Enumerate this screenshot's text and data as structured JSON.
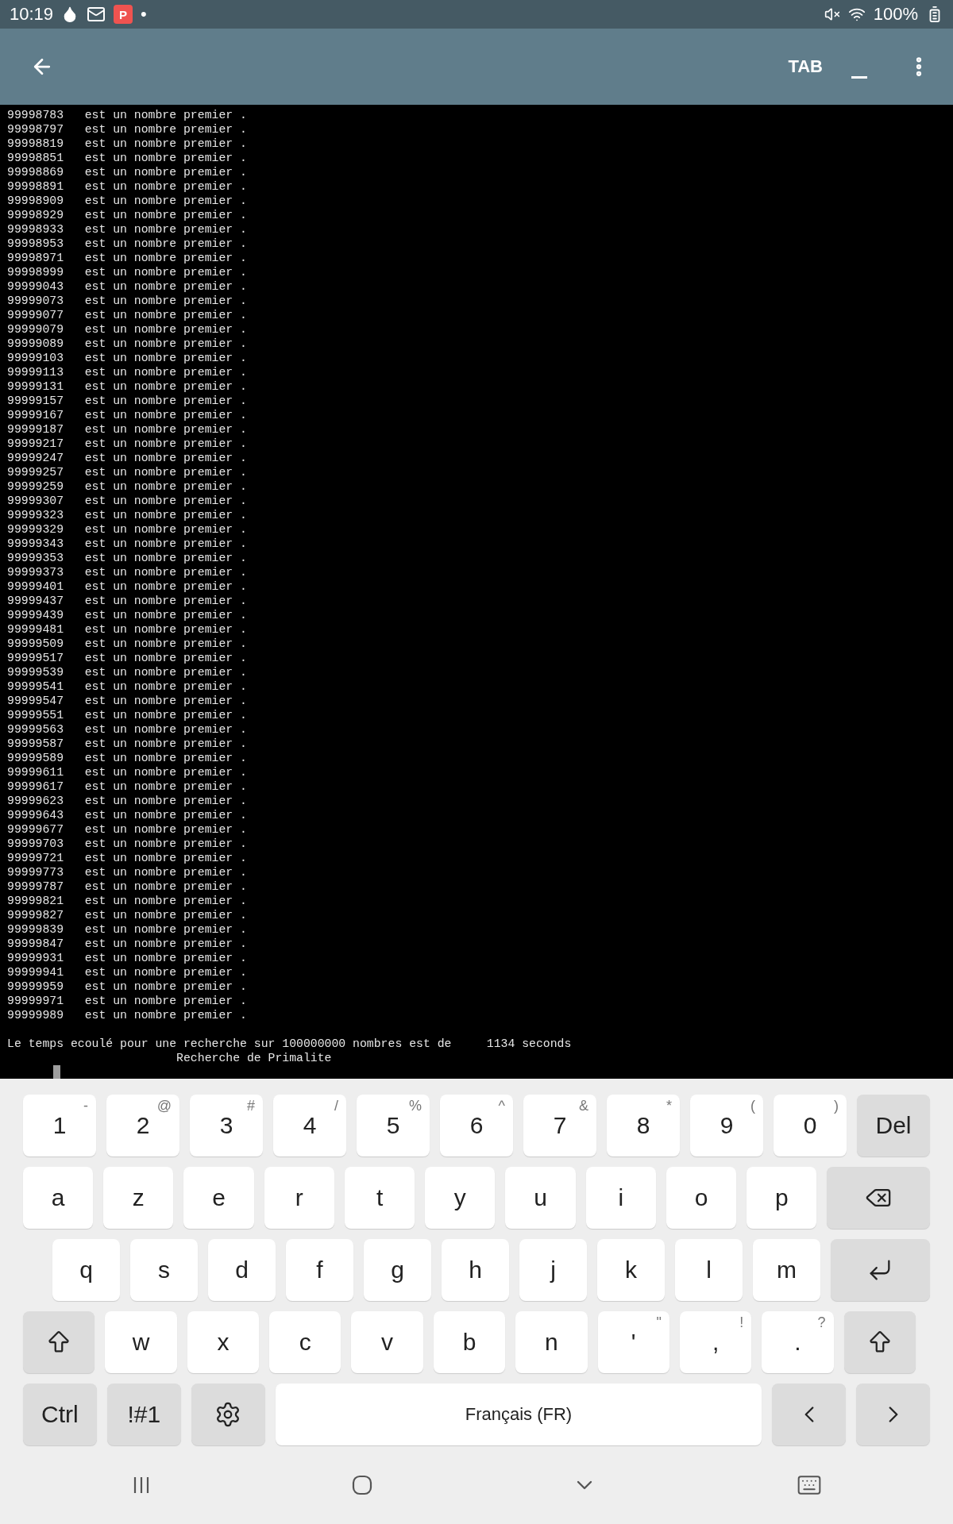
{
  "status_bar": {
    "time": "10:19",
    "app_badge": "P",
    "dot": "•",
    "battery": "100%"
  },
  "app_bar": {
    "tab_button": "TAB"
  },
  "terminal": {
    "lines": [
      "99998783   est un nombre premier .",
      "99998797   est un nombre premier .",
      "99998819   est un nombre premier .",
      "99998851   est un nombre premier .",
      "99998869   est un nombre premier .",
      "99998891   est un nombre premier .",
      "99998909   est un nombre premier .",
      "99998929   est un nombre premier .",
      "99998933   est un nombre premier .",
      "99998953   est un nombre premier .",
      "99998971   est un nombre premier .",
      "99998999   est un nombre premier .",
      "99999043   est un nombre premier .",
      "99999073   est un nombre premier .",
      "99999077   est un nombre premier .",
      "99999079   est un nombre premier .",
      "99999089   est un nombre premier .",
      "99999103   est un nombre premier .",
      "99999113   est un nombre premier .",
      "99999131   est un nombre premier .",
      "99999157   est un nombre premier .",
      "99999167   est un nombre premier .",
      "99999187   est un nombre premier .",
      "99999217   est un nombre premier .",
      "99999247   est un nombre premier .",
      "99999257   est un nombre premier .",
      "99999259   est un nombre premier .",
      "99999307   est un nombre premier .",
      "99999323   est un nombre premier .",
      "99999329   est un nombre premier .",
      "99999343   est un nombre premier .",
      "99999353   est un nombre premier .",
      "99999373   est un nombre premier .",
      "99999401   est un nombre premier .",
      "99999437   est un nombre premier .",
      "99999439   est un nombre premier .",
      "99999481   est un nombre premier .",
      "99999509   est un nombre premier .",
      "99999517   est un nombre premier .",
      "99999539   est un nombre premier .",
      "99999541   est un nombre premier .",
      "99999547   est un nombre premier .",
      "99999551   est un nombre premier .",
      "99999563   est un nombre premier .",
      "99999587   est un nombre premier .",
      "99999589   est un nombre premier .",
      "99999611   est un nombre premier .",
      "99999617   est un nombre premier .",
      "99999623   est un nombre premier .",
      "99999643   est un nombre premier .",
      "99999677   est un nombre premier .",
      "99999703   est un nombre premier .",
      "99999721   est un nombre premier .",
      "99999773   est un nombre premier .",
      "99999787   est un nombre premier .",
      "99999821   est un nombre premier .",
      "99999827   est un nombre premier .",
      "99999839   est un nombre premier .",
      "99999847   est un nombre premier .",
      "99999931   est un nombre premier .",
      "99999941   est un nombre premier .",
      "99999959   est un nombre premier .",
      "99999971   est un nombre premier .",
      "99999989   est un nombre premier ."
    ],
    "summary": [
      "Le temps ecoulé pour une recherche sur 100000000 nombres est de     1134 seconds",
      "                        Recherche de Primalite"
    ]
  },
  "keyboard": {
    "rows": [
      {
        "keys": [
          {
            "kind": "char",
            "label": "1",
            "sup": "-"
          },
          {
            "kind": "char",
            "label": "2",
            "sup": "@"
          },
          {
            "kind": "char",
            "label": "3",
            "sup": "#"
          },
          {
            "kind": "char",
            "label": "4",
            "sup": "/"
          },
          {
            "kind": "char",
            "label": "5",
            "sup": "%"
          },
          {
            "kind": "char",
            "label": "6",
            "sup": "^"
          },
          {
            "kind": "char",
            "label": "7",
            "sup": "&"
          },
          {
            "kind": "char",
            "label": "8",
            "sup": "*"
          },
          {
            "kind": "char",
            "label": "9",
            "sup": "("
          },
          {
            "kind": "char",
            "label": "0",
            "sup": ")"
          },
          {
            "kind": "function",
            "label": "Del"
          }
        ]
      },
      {
        "keys": [
          {
            "kind": "char",
            "label": "a"
          },
          {
            "kind": "char",
            "label": "z"
          },
          {
            "kind": "char",
            "label": "e"
          },
          {
            "kind": "char",
            "label": "r"
          },
          {
            "kind": "char",
            "label": "t"
          },
          {
            "kind": "char",
            "label": "y"
          },
          {
            "kind": "char",
            "label": "u"
          },
          {
            "kind": "char",
            "label": "i"
          },
          {
            "kind": "char",
            "label": "o"
          },
          {
            "kind": "char",
            "label": "p"
          },
          {
            "kind": "backspace"
          }
        ]
      },
      {
        "keys": [
          {
            "kind": "char",
            "label": "q"
          },
          {
            "kind": "char",
            "label": "s"
          },
          {
            "kind": "char",
            "label": "d"
          },
          {
            "kind": "char",
            "label": "f"
          },
          {
            "kind": "char",
            "label": "g"
          },
          {
            "kind": "char",
            "label": "h"
          },
          {
            "kind": "char",
            "label": "j"
          },
          {
            "kind": "char",
            "label": "k"
          },
          {
            "kind": "char",
            "label": "l"
          },
          {
            "kind": "char",
            "label": "m"
          },
          {
            "kind": "enter"
          }
        ]
      },
      {
        "keys": [
          {
            "kind": "shift"
          },
          {
            "kind": "char",
            "label": "w"
          },
          {
            "kind": "char",
            "label": "x"
          },
          {
            "kind": "char",
            "label": "c"
          },
          {
            "kind": "char",
            "label": "v"
          },
          {
            "kind": "char",
            "label": "b"
          },
          {
            "kind": "char",
            "label": "n"
          },
          {
            "kind": "char",
            "label": "'",
            "sup": "\""
          },
          {
            "kind": "char",
            "label": ",",
            "sup": "!"
          },
          {
            "kind": "char",
            "label": ".",
            "sup": "?"
          },
          {
            "kind": "shift"
          }
        ]
      },
      {
        "keys": [
          {
            "kind": "function",
            "label": "Ctrl"
          },
          {
            "kind": "function",
            "label": "!#1"
          },
          {
            "kind": "settings"
          },
          {
            "kind": "space",
            "label": "Français (FR)"
          },
          {
            "kind": "left"
          },
          {
            "kind": "right"
          }
        ]
      }
    ]
  }
}
